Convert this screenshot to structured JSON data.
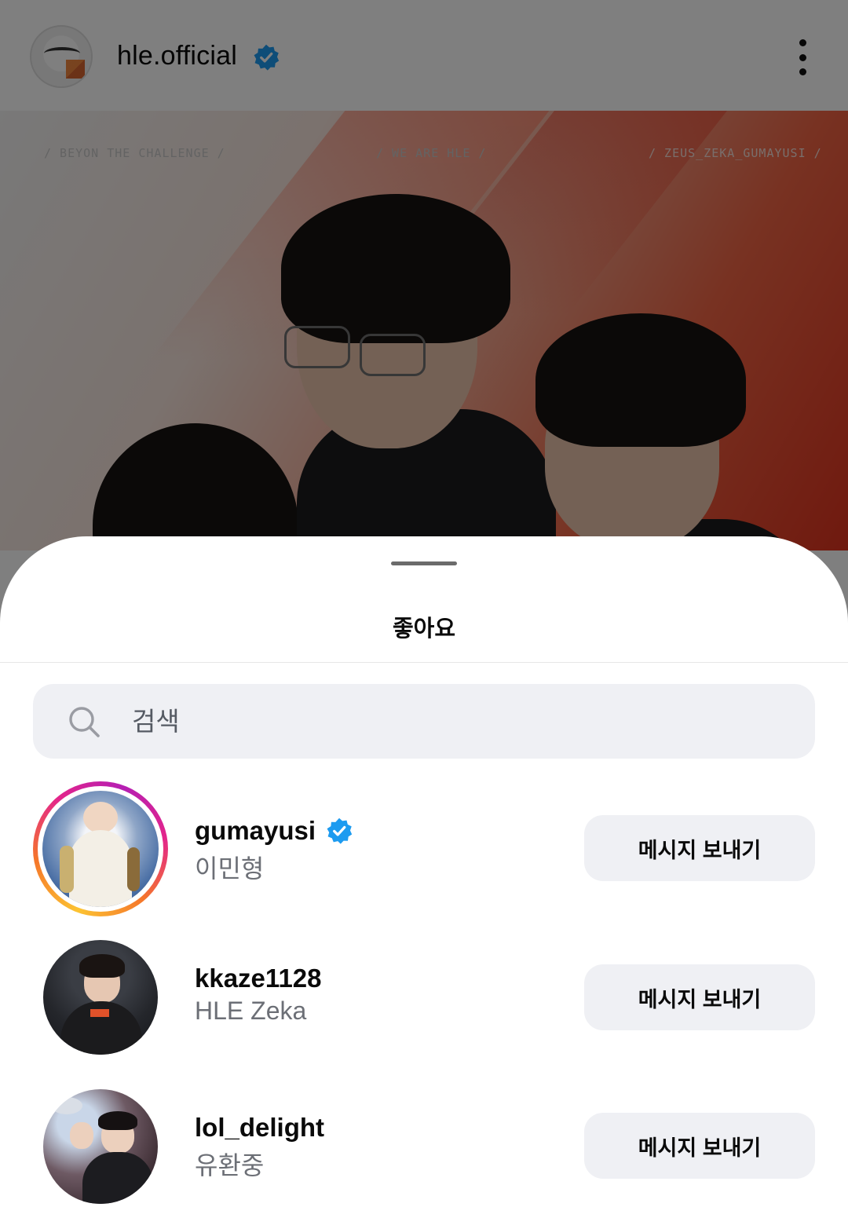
{
  "post": {
    "username": "hle.official",
    "taglines": [
      "/ BEYON THE CHALLENGE /",
      "/ WE ARE HLE /",
      "/ ZEUS_ZEKA_GUMAYUSI /"
    ]
  },
  "sheet": {
    "title": "좋아요",
    "search_placeholder": "검색"
  },
  "likers": [
    {
      "username": "gumayusi",
      "full_name": "이민형",
      "verified": true,
      "has_story": true,
      "button": "메시지 보내기"
    },
    {
      "username": "kkaze1128",
      "full_name": "HLE Zeka",
      "verified": false,
      "has_story": false,
      "button": "메시지 보내기"
    },
    {
      "username": "lol_delight",
      "full_name": "유환중",
      "verified": false,
      "has_story": false,
      "button": "메시지 보내기"
    }
  ],
  "colors": {
    "verified": "#1d9bf0",
    "button_bg": "#eff0f4",
    "secondary_text": "#6c6f76",
    "dim_overlay": "rgba(0,0,0,0.5)"
  },
  "icons": [
    "more-vert-icon",
    "verified-badge-icon",
    "search-icon"
  ]
}
